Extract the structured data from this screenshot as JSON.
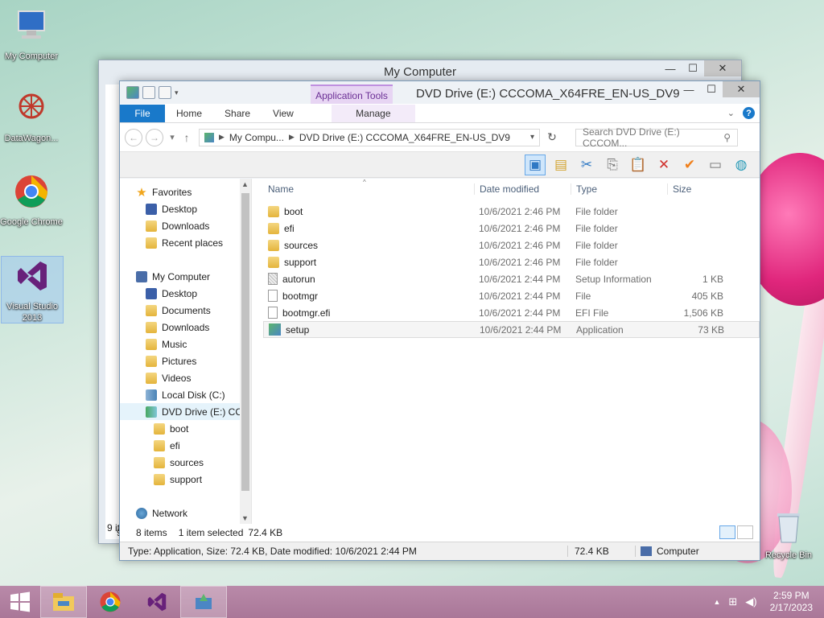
{
  "desktop": {
    "icons": [
      {
        "label": "My Computer"
      },
      {
        "label": "DataWagon..."
      },
      {
        "label": "Google Chrome"
      },
      {
        "label": "Visual Studio 2013"
      }
    ],
    "recycle_bin": "Recycle Bin"
  },
  "back_window": {
    "title": "My Computer",
    "status_fragment": "9 it",
    "side_fragment": "9"
  },
  "explorer": {
    "title": "DVD Drive (E:) CCCOMA_X64FRE_EN-US_DV9",
    "context_group": "Application Tools",
    "tabs": {
      "file": "File",
      "home": "Home",
      "share": "Share",
      "view": "View",
      "manage": "Manage"
    },
    "address": {
      "crumbs": [
        "My Compu...",
        "DVD Drive (E:) CCCOMA_X64FRE_EN-US_DV9"
      ]
    },
    "search": {
      "placeholder": "Search DVD Drive (E:) CCCOM..."
    },
    "nav": {
      "favorites": "Favorites",
      "fav_items": [
        "Desktop",
        "Downloads",
        "Recent places"
      ],
      "computer": "My Computer",
      "pc_items": [
        "Desktop",
        "Documents",
        "Downloads",
        "Music",
        "Pictures",
        "Videos",
        "Local Disk (C:)",
        "DVD Drive (E:) CC"
      ],
      "dvd_children": [
        "boot",
        "efi",
        "sources",
        "support"
      ],
      "network": "Network"
    },
    "columns": {
      "name": "Name",
      "date": "Date modified",
      "type": "Type",
      "size": "Size"
    },
    "files": [
      {
        "name": "boot",
        "date": "10/6/2021 2:46 PM",
        "type": "File folder",
        "size": "",
        "kind": "folder"
      },
      {
        "name": "efi",
        "date": "10/6/2021 2:46 PM",
        "type": "File folder",
        "size": "",
        "kind": "folder"
      },
      {
        "name": "sources",
        "date": "10/6/2021 2:46 PM",
        "type": "File folder",
        "size": "",
        "kind": "folder"
      },
      {
        "name": "support",
        "date": "10/6/2021 2:46 PM",
        "type": "File folder",
        "size": "",
        "kind": "folder"
      },
      {
        "name": "autorun",
        "date": "10/6/2021 2:44 PM",
        "type": "Setup Information",
        "size": "1 KB",
        "kind": "inf"
      },
      {
        "name": "bootmgr",
        "date": "10/6/2021 2:44 PM",
        "type": "File",
        "size": "405 KB",
        "kind": "file"
      },
      {
        "name": "bootmgr.efi",
        "date": "10/6/2021 2:44 PM",
        "type": "EFI File",
        "size": "1,506 KB",
        "kind": "file"
      },
      {
        "name": "setup",
        "date": "10/6/2021 2:44 PM",
        "type": "Application",
        "size": "73 KB",
        "kind": "app"
      }
    ],
    "status": {
      "count": "8 items",
      "selected": "1 item selected",
      "sel_size": "72.4 KB"
    },
    "details": {
      "text": "Type: Application, Size: 72.4 KB, Date modified: 10/6/2021 2:44 PM",
      "size": "72.4 KB",
      "zone": "Computer"
    }
  },
  "taskbar": {
    "time": "2:59 PM",
    "date": "2/17/2023"
  }
}
